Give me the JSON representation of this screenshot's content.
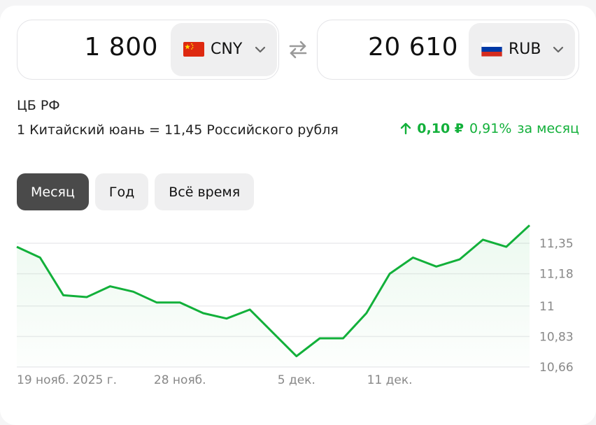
{
  "converter": {
    "from": {
      "amount": "1 800",
      "code": "CNY",
      "flag": "china-flag"
    },
    "to": {
      "amount": "20 610",
      "code": "RUB",
      "flag": "russia-flag"
    },
    "swap_icon": "swap-arrows-icon"
  },
  "rate_info": {
    "source": "ЦБ РФ",
    "text": "1 Китайский юань = 11,45 Российского рубля",
    "change_abs": "0,10 ₽",
    "change_pct": "0,91%",
    "change_period": "за месяц",
    "change_color": "#12b03a"
  },
  "tabs": [
    {
      "label": "Месяц",
      "active": true
    },
    {
      "label": "Год",
      "active": false
    },
    {
      "label": "Всё время",
      "active": false
    }
  ],
  "chart_data": {
    "type": "area",
    "y_ticks": [
      "11,35",
      "11,18",
      "11",
      "10,83",
      "10,66"
    ],
    "y_tick_values": [
      11.35,
      11.18,
      11.0,
      10.83,
      10.66
    ],
    "x_tick_labels": [
      {
        "label": "19 нояб. 2025 г.",
        "index": 0
      },
      {
        "label": "28 нояб.",
        "index": 7
      },
      {
        "label": "5 дек.",
        "index": 12
      },
      {
        "label": "11 дек.",
        "index": 16
      }
    ],
    "values": [
      11.33,
      11.27,
      11.06,
      11.05,
      11.11,
      11.08,
      11.02,
      11.02,
      10.96,
      10.93,
      10.98,
      10.85,
      10.72,
      10.82,
      10.82,
      10.96,
      11.18,
      11.27,
      11.22,
      11.26,
      11.37,
      11.33,
      11.45
    ],
    "ylim": [
      10.66,
      11.45
    ],
    "line_color": "#12b03a",
    "grid": true
  }
}
